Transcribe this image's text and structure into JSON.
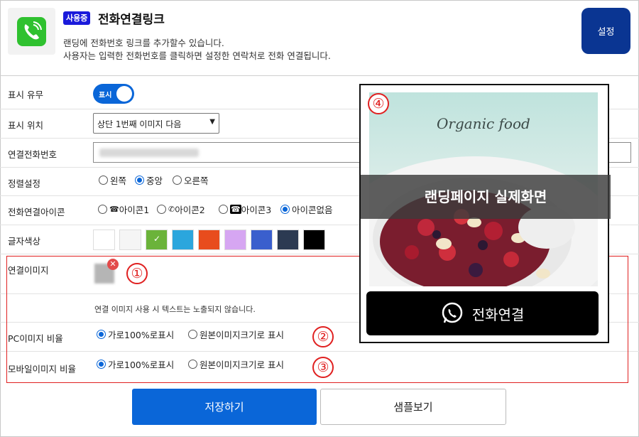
{
  "header": {
    "badge": "사용중",
    "title": "전화연결링크",
    "desc_line1": "랜딩에 전화번호 링크를 추가할수 있습니다.",
    "desc_line2": "사용자는 입력한 전화번호를 클릭하면 설정한 연락처로 전화 연결됩니다.",
    "settings_button": "설정",
    "icon": "phone-icon"
  },
  "form": {
    "display": {
      "label": "표시 유무",
      "toggle_label": "표시",
      "on": true
    },
    "position": {
      "label": "표시 위치",
      "selected": "상단 1번째 이미지 다음"
    },
    "phone": {
      "label": "연결전화번호"
    },
    "align": {
      "label": "정렬설정",
      "options": [
        "왼쪽",
        "중앙",
        "오른쪽"
      ],
      "selected_index": 1
    },
    "call_icon": {
      "label": "전화연결아이콘",
      "options": [
        "아이콘1",
        "아이콘2",
        "아이콘3",
        "아이콘없음"
      ],
      "selected_index": 3
    },
    "text_color": {
      "label": "글자색상",
      "colors": [
        "#ffffff",
        "#f5f5f5",
        "#6bb33a",
        "#2ba6dd",
        "#e84c1d",
        "#d6a6f2",
        "#3a5fcd",
        "#2c3a52",
        "#000000"
      ],
      "selected_index": 2
    },
    "link_image": {
      "label": "연결이미지",
      "note": "연결 이미지 사용 시 텍스트는 노출되지 않습니다."
    },
    "pc_ratio": {
      "label": "PC이미지 비율",
      "options": [
        "가로100%로표시",
        "원본이미지크기로 표시"
      ],
      "selected_index": 0
    },
    "mobile_ratio": {
      "label": "모바일이미지 비율",
      "options": [
        "가로100%로표시",
        "원본이미지크기로 표시"
      ],
      "selected_index": 0
    }
  },
  "markers": [
    "①",
    "②",
    "③",
    "④"
  ],
  "preview": {
    "image_text": "Organic food",
    "overlay_text": "랜딩페이지 실제화면",
    "button_label": "전화연결"
  },
  "buttons": {
    "save": "저장하기",
    "sample": "샘플보기"
  },
  "colors": {
    "primary": "#0a66d8",
    "settings": "#0a3592",
    "badge": "#1a1adb",
    "marker": "#e02020"
  }
}
